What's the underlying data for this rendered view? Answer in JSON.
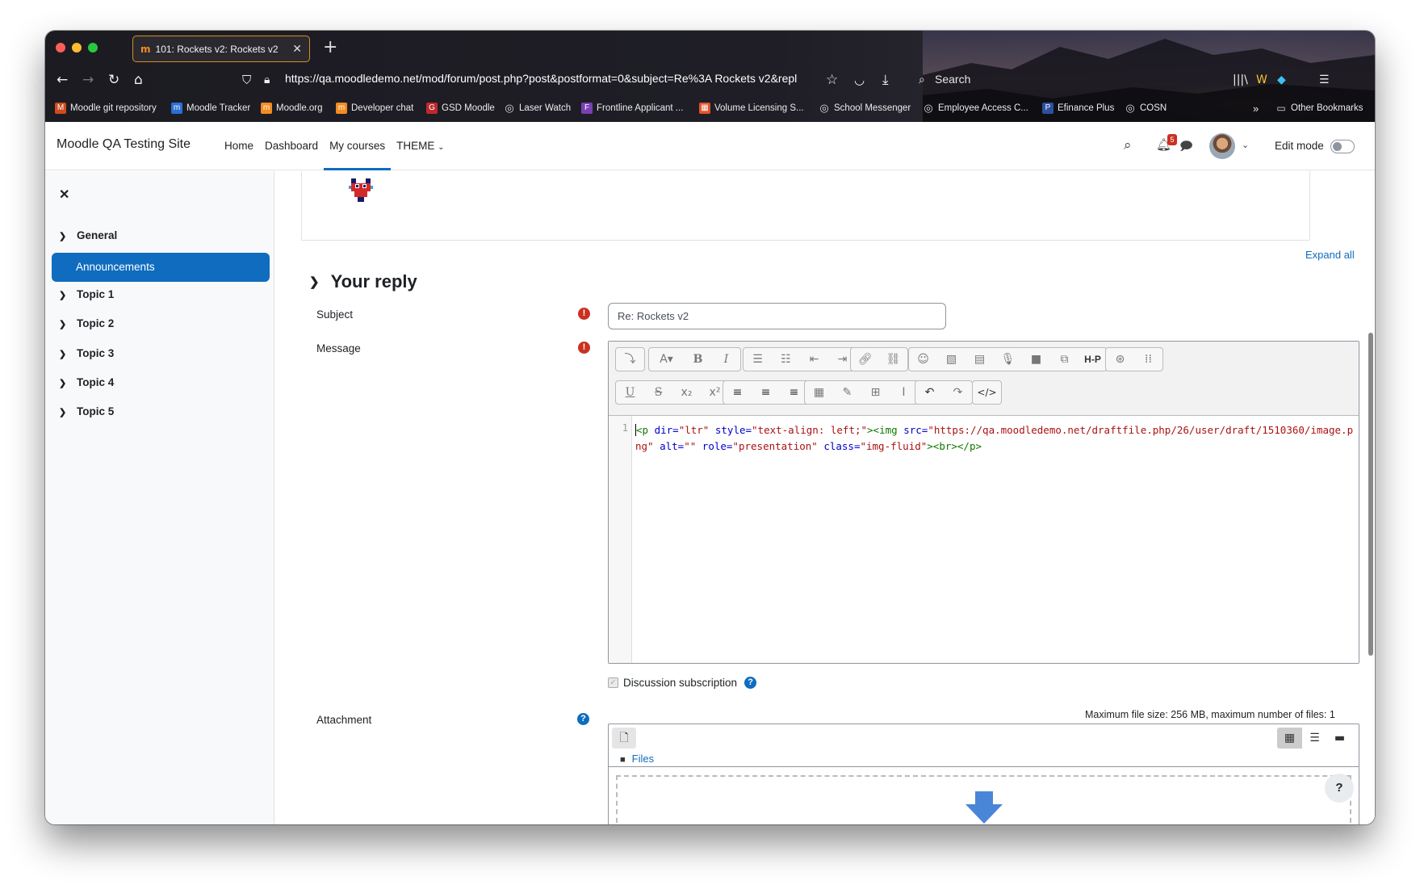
{
  "browser": {
    "tab_title": "101: Rockets v2: Rockets v2",
    "tab_favicon": "m",
    "url": "https://qa.moodledemo.net/mod/forum/post.php?post&postformat=0&subject=Re%3A Rockets v2&repl",
    "search_label": "Search",
    "bookmarks": [
      {
        "label": "Moodle git repository",
        "icon": "M",
        "color": "#d14a1f"
      },
      {
        "label": "Moodle Tracker",
        "icon": "m",
        "color": "#2b6fd6"
      },
      {
        "label": "Moodle.org",
        "icon": "m",
        "color": "#f48b22"
      },
      {
        "label": "Developer chat",
        "icon": "m",
        "color": "#f48b22"
      },
      {
        "label": "GSD Moodle",
        "icon": "G",
        "color": "#c0282d"
      },
      {
        "label": "Laser Watch",
        "icon": "◎",
        "color": "#555555"
      },
      {
        "label": "Frontline Applicant ...",
        "icon": "F",
        "color": "#7a3fb3"
      },
      {
        "label": "Volume Licensing S...",
        "icon": "▦",
        "color": "#e2542a"
      },
      {
        "label": "School Messenger",
        "icon": "◎",
        "color": "#555555"
      },
      {
        "label": "Employee Access C...",
        "icon": "◎",
        "color": "#555555"
      },
      {
        "label": "Efinance Plus",
        "icon": "P",
        "color": "#2c4fa0"
      },
      {
        "label": "COSN",
        "icon": "◎",
        "color": "#555555"
      }
    ],
    "other_bookmarks": "Other Bookmarks"
  },
  "moodle": {
    "site_name": "Moodle QA Testing Site",
    "nav": [
      "Home",
      "Dashboard",
      "My courses",
      "THEME"
    ],
    "notification_count": "5",
    "edit_mode_label": "Edit mode",
    "accent": "#0f6cbf"
  },
  "drawer": {
    "sections": [
      "General",
      "Topic 1",
      "Topic 2",
      "Topic 3",
      "Topic 4",
      "Topic 5"
    ],
    "active_item": "Announcements"
  },
  "form": {
    "expand_all": "Expand all",
    "heading": "Your reply",
    "subject_label": "Subject",
    "subject_value": "Re: Rockets v2",
    "message_label": "Message",
    "line_number": "1",
    "code": {
      "t1": "<p",
      "a1": " dir=",
      "s1": "\"ltr\"",
      "a2": " style=",
      "s2": "\"text-align: left;\"",
      "t2": "><img",
      "a3": " src=",
      "s3": "\"https://qa.moodledemo.net/draftfile.php/26/user/draft/1510360/image.png\"",
      "a4": " alt=",
      "s4": "\"\"",
      "a5": " role=",
      "s5": "\"presentation\"",
      "a6": " class=",
      "s6": "\"img-fluid\"",
      "t3": "><br></p>"
    },
    "discussion_subscription": "Discussion subscription",
    "attachment_label": "Attachment",
    "max_file_info": "Maximum file size: 256 MB, maximum number of files: 1",
    "files_label": "Files"
  }
}
